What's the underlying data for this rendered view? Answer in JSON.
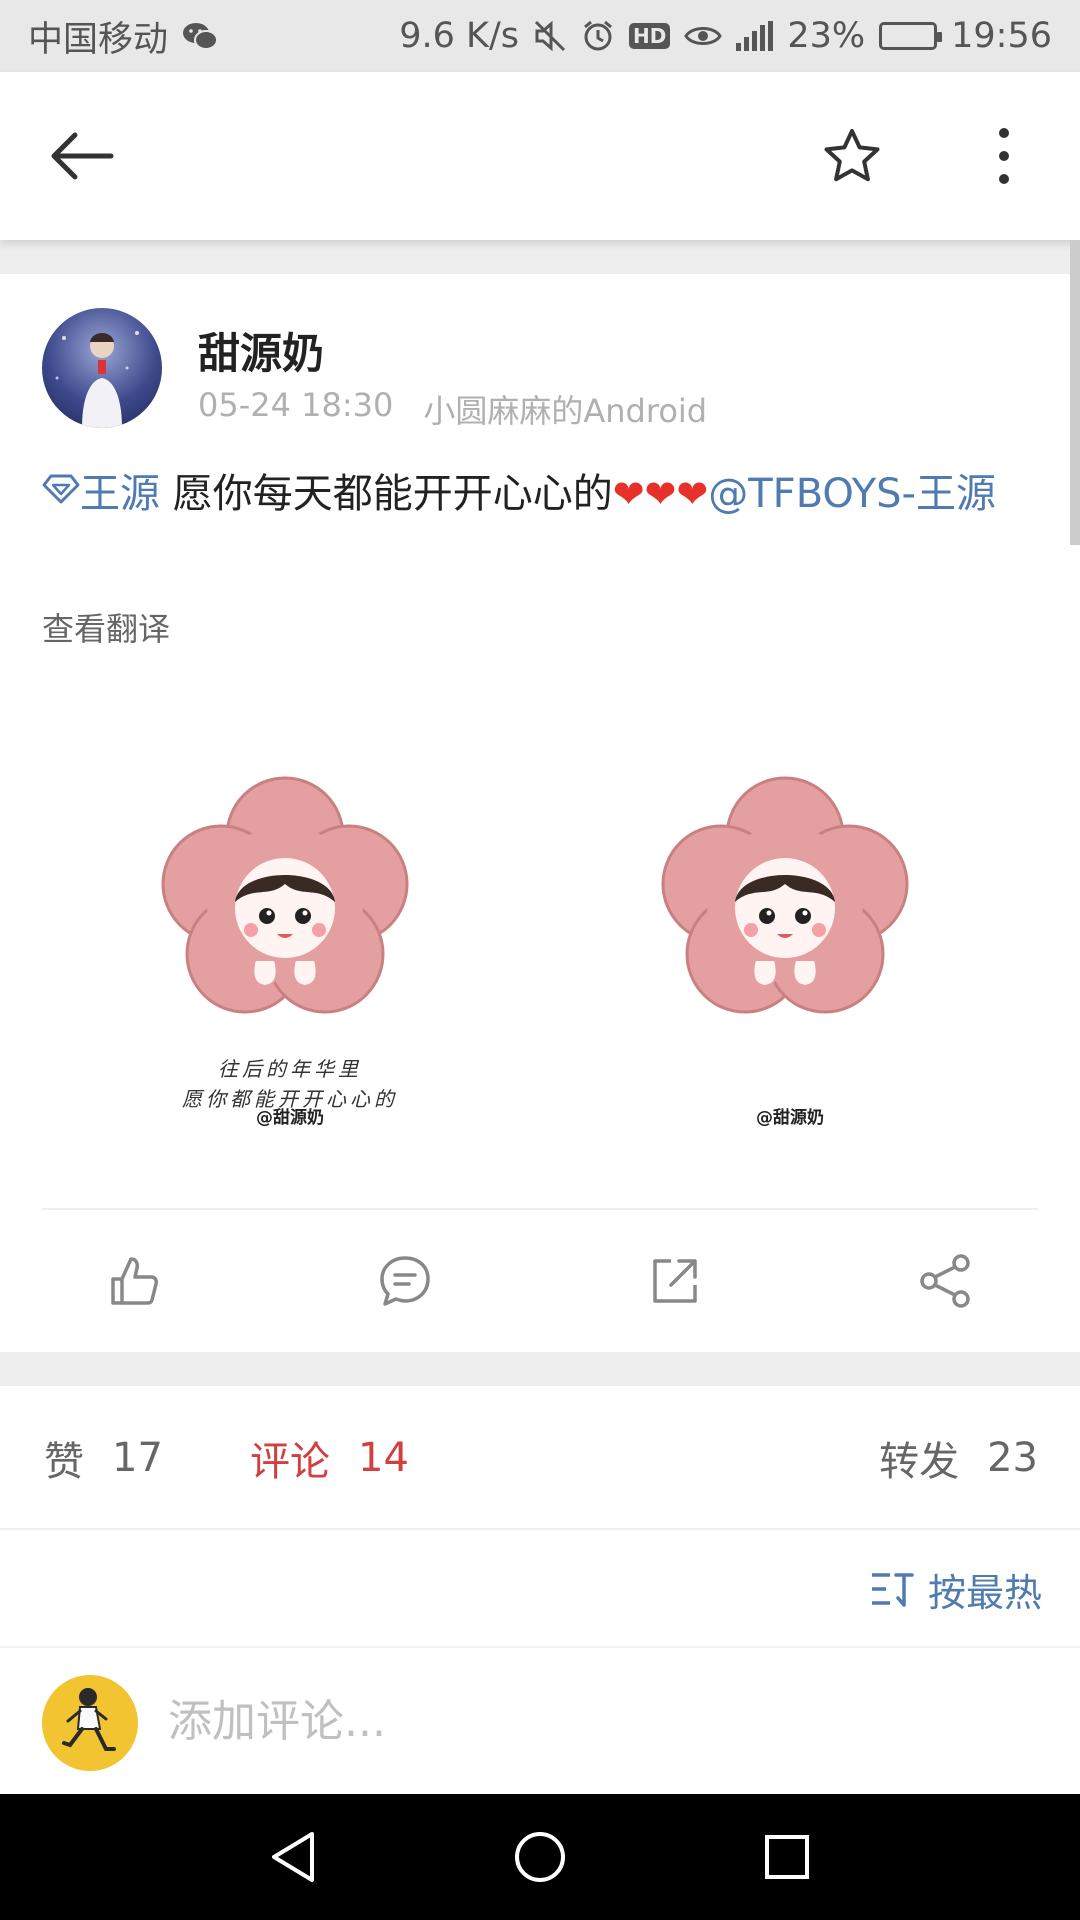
{
  "status_bar": {
    "carrier": "中国移动",
    "speed": "9.6 K/s",
    "battery": "23%",
    "battery_level": 0.23,
    "time": "19:56",
    "icons": [
      "wechat-icon",
      "mute-icon",
      "alarm-icon",
      "hd-icon",
      "eye-icon",
      "signal-icon",
      "battery-icon"
    ]
  },
  "toolbar": {
    "icons": [
      "back-arrow-icon",
      "star-icon",
      "more-vertical-icon"
    ]
  },
  "post": {
    "author": "甜源奶",
    "date": "05-24 18:30",
    "source": "小圆麻麻的Android",
    "topic_tag": "王源",
    "text": " 愿你每天都能开开心心的",
    "hearts": "❤❤❤",
    "mention": "@TFBOYS-王源",
    "translate": "查看翻译",
    "images": [
      {
        "caption_line1": "往后的年华里",
        "caption_line2": "愿你都能开开心心的",
        "watermark": "@甜源奶"
      },
      {
        "watermark": "@甜源奶"
      }
    ],
    "actions": [
      "like-icon",
      "comment-icon",
      "forward-icon",
      "share-icon"
    ]
  },
  "stats": {
    "likes_label": "赞",
    "likes": "17",
    "comments_label": "评论",
    "comments": "14",
    "reposts_label": "转发",
    "reposts": "23",
    "active_color": "#d13f3f"
  },
  "sort": {
    "label": "按最热"
  },
  "comment_bar": {
    "placeholder": "添加评论..."
  },
  "nav_bar": {
    "icons": [
      "nav-back-icon",
      "nav-home-icon",
      "nav-recents-icon"
    ]
  },
  "colors": {
    "link": "#4f7bb0",
    "accent_red": "#d13f3f"
  }
}
